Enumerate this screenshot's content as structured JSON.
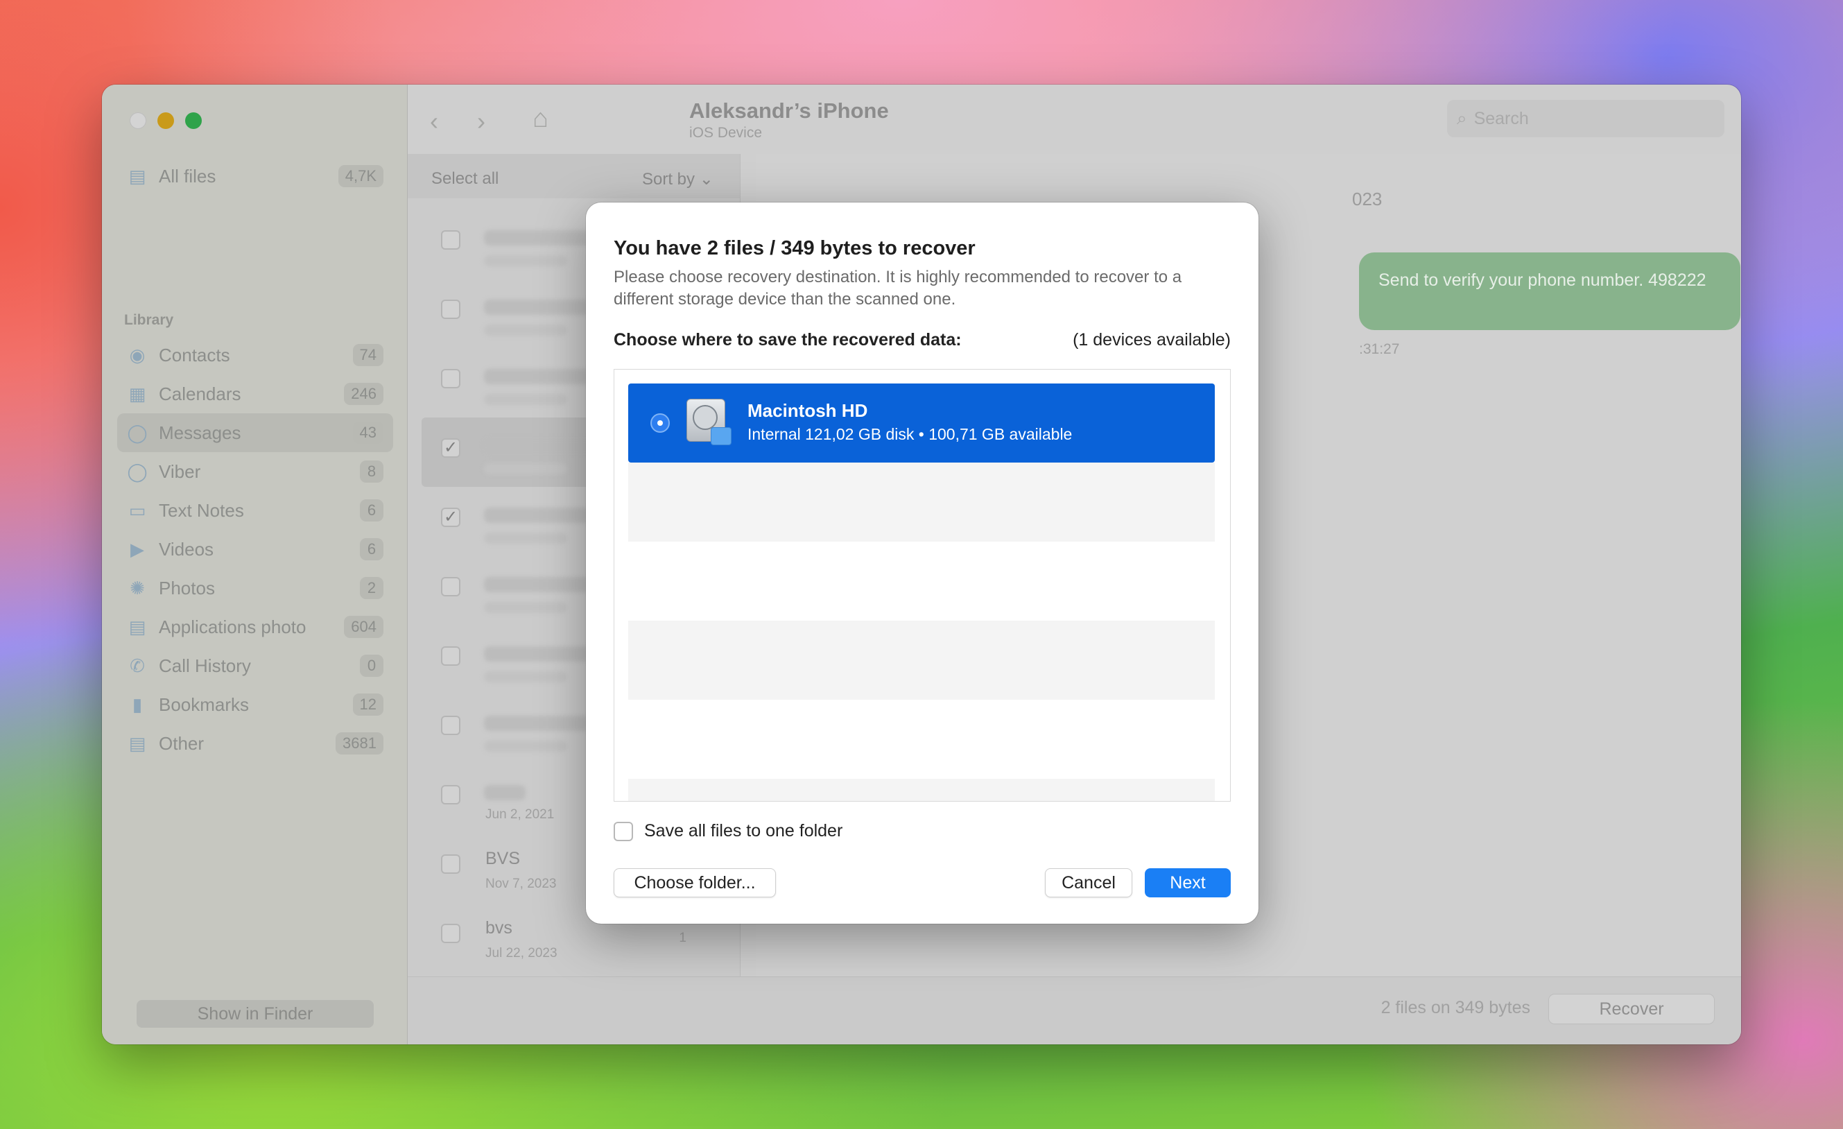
{
  "app": {
    "device_title": "Aleksandr’s iPhone",
    "device_subtitle": "iOS Device",
    "search_placeholder": "Search"
  },
  "sidebar": {
    "all_files": {
      "label": "All files",
      "count": "4,7K",
      "icon": "files-icon"
    },
    "section_label": "Library",
    "items": [
      {
        "label": "Contacts",
        "count": "74",
        "icon": "contacts-icon"
      },
      {
        "label": "Calendars",
        "count": "246",
        "icon": "calendar-icon"
      },
      {
        "label": "Messages",
        "count": "43",
        "icon": "message-icon"
      },
      {
        "label": "Viber",
        "count": "8",
        "icon": "viber-icon"
      },
      {
        "label": "Text Notes",
        "count": "6",
        "icon": "notes-icon"
      },
      {
        "label": "Videos",
        "count": "6",
        "icon": "video-icon"
      },
      {
        "label": "Photos",
        "count": "2",
        "icon": "photos-icon"
      },
      {
        "label": "Applications photo",
        "count": "604",
        "icon": "app-photo-icon"
      },
      {
        "label": "Call History",
        "count": "0",
        "icon": "phone-icon"
      },
      {
        "label": "Bookmarks",
        "count": "12",
        "icon": "bookmark-icon"
      },
      {
        "label": "Other",
        "count": "3681",
        "icon": "other-icon"
      }
    ],
    "show_in_finder": "Show in Finder"
  },
  "list": {
    "select_all": "Select all",
    "sort_by": "Sort by",
    "rows": [
      {
        "name": "",
        "date": "",
        "count": "",
        "checked": false
      },
      {
        "name": "",
        "date": "",
        "count": "",
        "checked": false
      },
      {
        "name": "",
        "date": "",
        "count": "",
        "checked": false
      },
      {
        "name": "",
        "date": "",
        "count": "",
        "checked": true
      },
      {
        "name": "",
        "date": "",
        "count": "",
        "checked": true
      },
      {
        "name": "",
        "date": "",
        "count": "",
        "checked": false
      },
      {
        "name": "",
        "date": "",
        "count": "",
        "checked": false
      },
      {
        "name": "",
        "date": "",
        "count": "",
        "checked": false
      },
      {
        "name": "",
        "date": "Jun 2, 2021",
        "count": "",
        "checked": false
      },
      {
        "name": "BVS",
        "date": "Nov 7, 2023",
        "count": "",
        "checked": false
      },
      {
        "name": "bvs",
        "date": "Jul 22, 2023",
        "count": "1",
        "checked": false
      }
    ]
  },
  "detail": {
    "date_fragment": "023",
    "bubble_text": "Send to verify your phone number. 498222",
    "time_fragment": ":31:27"
  },
  "footer": {
    "files_info": "2 files on 349 bytes",
    "recover": "Recover"
  },
  "modal": {
    "title": "You have 2 files / 349 bytes to recover",
    "description": "Please choose recovery destination. It is highly recommended to recover to a different storage device than the scanned one.",
    "choose_label": "Choose where to save the recovered data:",
    "devices_available": "(1 devices available)",
    "device": {
      "name": "Macintosh HD",
      "info": "Internal 121,02 GB disk • 100,71 GB available",
      "icon": "hard-disk-icon"
    },
    "save_one_folder": "Save all files to one folder",
    "choose_folder": "Choose folder...",
    "cancel": "Cancel",
    "next": "Next"
  },
  "colors": {
    "accent": "#1a7ff5",
    "selection": "#0a62d8",
    "bubble": "#88b38c"
  }
}
